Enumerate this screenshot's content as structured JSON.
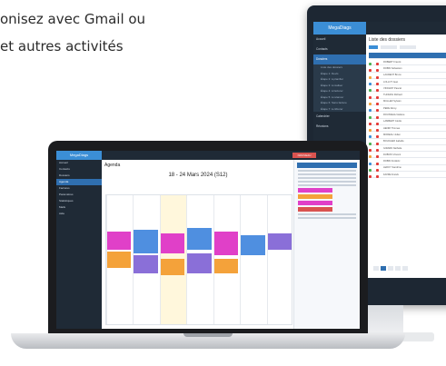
{
  "headline": {
    "line1": "onisez avec Gmail ou",
    "line2": "et autres activités"
  },
  "monitor": {
    "brand": "MegaDiags",
    "title": "Liste des dossiers",
    "nav": [
      "Accueil",
      "Contacts",
      "Dossiers"
    ],
    "subnav": [
      "Liste des dossiers",
      "Étape 1: Devis",
      "Étape 2: à planifier",
      "Étape 3: à réaliser",
      "Étape 4: à facturer",
      "Étape 5: à relancer",
      "Étape 6: Sans facture",
      "Étape 7: à clôturer"
    ],
    "nav_bottom": [
      "Calendrier",
      "Réunions"
    ],
    "rows": [
      "ROBERT Franck",
      "ROBIN Sébastien",
      "LAURENT Bruno",
      "LOLLOT Jean",
      "VINCENT Pascal",
      "THOMAS Richard",
      "MULLER Sylvain",
      "PERE Rémy",
      "ROUSSEAU Hélène",
      "LAMBERT Cécile",
      "HENRI Thomas",
      "MOREAU Julien",
      "BOUCHER Isabelle",
      "GIRARD Nathalie",
      "DUBOIS Vincent",
      "ROBIN Frédéric",
      "LEROY Sandrine",
      "FAVRE Franck"
    ]
  },
  "laptop": {
    "brand": "MegaDiags",
    "title": "Agenda",
    "date_range": "18 - 24 Mars 2024 (S12)",
    "new_button": "NOUVEAU",
    "nav": [
      "Accueil",
      "Contacts",
      "Dossiers",
      "Agenda",
      "Factures",
      "Paramètres",
      "Statistiques",
      "Mails",
      "Aide"
    ],
    "days": [
      "lun. 18/3",
      "mar. 19/3",
      "mer. 20/3",
      "jeu. 21/3",
      "ven. 22/3",
      "sam. 23/3",
      "dim. 24/3"
    ]
  },
  "colors": {
    "sidebar": "#1f2a36",
    "accent": "#2f6fb0",
    "magenta": "#e040c8",
    "orange": "#f4a23a",
    "blue": "#4f8fe0",
    "purple": "#8a6fd8"
  }
}
